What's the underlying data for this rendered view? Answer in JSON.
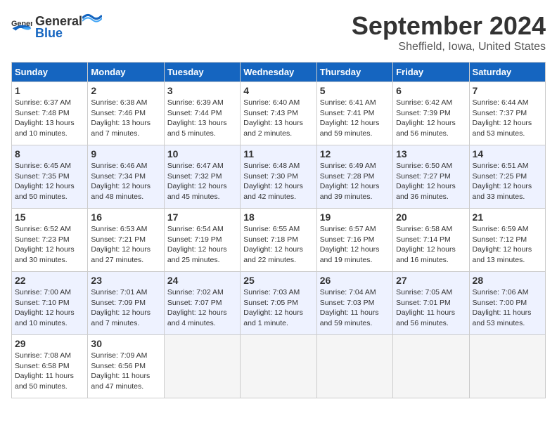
{
  "header": {
    "logo_general": "General",
    "logo_blue": "Blue",
    "title": "September 2024",
    "location": "Sheffield, Iowa, United States"
  },
  "columns": [
    "Sunday",
    "Monday",
    "Tuesday",
    "Wednesday",
    "Thursday",
    "Friday",
    "Saturday"
  ],
  "weeks": [
    [
      {
        "day": "1",
        "sunrise": "6:37 AM",
        "sunset": "7:48 PM",
        "daylight": "13 hours and 10 minutes."
      },
      {
        "day": "2",
        "sunrise": "6:38 AM",
        "sunset": "7:46 PM",
        "daylight": "13 hours and 7 minutes."
      },
      {
        "day": "3",
        "sunrise": "6:39 AM",
        "sunset": "7:44 PM",
        "daylight": "13 hours and 5 minutes."
      },
      {
        "day": "4",
        "sunrise": "6:40 AM",
        "sunset": "7:43 PM",
        "daylight": "13 hours and 2 minutes."
      },
      {
        "day": "5",
        "sunrise": "6:41 AM",
        "sunset": "7:41 PM",
        "daylight": "12 hours and 59 minutes."
      },
      {
        "day": "6",
        "sunrise": "6:42 AM",
        "sunset": "7:39 PM",
        "daylight": "12 hours and 56 minutes."
      },
      {
        "day": "7",
        "sunrise": "6:44 AM",
        "sunset": "7:37 PM",
        "daylight": "12 hours and 53 minutes."
      }
    ],
    [
      {
        "day": "8",
        "sunrise": "6:45 AM",
        "sunset": "7:35 PM",
        "daylight": "12 hours and 50 minutes."
      },
      {
        "day": "9",
        "sunrise": "6:46 AM",
        "sunset": "7:34 PM",
        "daylight": "12 hours and 48 minutes."
      },
      {
        "day": "10",
        "sunrise": "6:47 AM",
        "sunset": "7:32 PM",
        "daylight": "12 hours and 45 minutes."
      },
      {
        "day": "11",
        "sunrise": "6:48 AM",
        "sunset": "7:30 PM",
        "daylight": "12 hours and 42 minutes."
      },
      {
        "day": "12",
        "sunrise": "6:49 AM",
        "sunset": "7:28 PM",
        "daylight": "12 hours and 39 minutes."
      },
      {
        "day": "13",
        "sunrise": "6:50 AM",
        "sunset": "7:27 PM",
        "daylight": "12 hours and 36 minutes."
      },
      {
        "day": "14",
        "sunrise": "6:51 AM",
        "sunset": "7:25 PM",
        "daylight": "12 hours and 33 minutes."
      }
    ],
    [
      {
        "day": "15",
        "sunrise": "6:52 AM",
        "sunset": "7:23 PM",
        "daylight": "12 hours and 30 minutes."
      },
      {
        "day": "16",
        "sunrise": "6:53 AM",
        "sunset": "7:21 PM",
        "daylight": "12 hours and 27 minutes."
      },
      {
        "day": "17",
        "sunrise": "6:54 AM",
        "sunset": "7:19 PM",
        "daylight": "12 hours and 25 minutes."
      },
      {
        "day": "18",
        "sunrise": "6:55 AM",
        "sunset": "7:18 PM",
        "daylight": "12 hours and 22 minutes."
      },
      {
        "day": "19",
        "sunrise": "6:57 AM",
        "sunset": "7:16 PM",
        "daylight": "12 hours and 19 minutes."
      },
      {
        "day": "20",
        "sunrise": "6:58 AM",
        "sunset": "7:14 PM",
        "daylight": "12 hours and 16 minutes."
      },
      {
        "day": "21",
        "sunrise": "6:59 AM",
        "sunset": "7:12 PM",
        "daylight": "12 hours and 13 minutes."
      }
    ],
    [
      {
        "day": "22",
        "sunrise": "7:00 AM",
        "sunset": "7:10 PM",
        "daylight": "12 hours and 10 minutes."
      },
      {
        "day": "23",
        "sunrise": "7:01 AM",
        "sunset": "7:09 PM",
        "daylight": "12 hours and 7 minutes."
      },
      {
        "day": "24",
        "sunrise": "7:02 AM",
        "sunset": "7:07 PM",
        "daylight": "12 hours and 4 minutes."
      },
      {
        "day": "25",
        "sunrise": "7:03 AM",
        "sunset": "7:05 PM",
        "daylight": "12 hours and 1 minute."
      },
      {
        "day": "26",
        "sunrise": "7:04 AM",
        "sunset": "7:03 PM",
        "daylight": "11 hours and 59 minutes."
      },
      {
        "day": "27",
        "sunrise": "7:05 AM",
        "sunset": "7:01 PM",
        "daylight": "11 hours and 56 minutes."
      },
      {
        "day": "28",
        "sunrise": "7:06 AM",
        "sunset": "7:00 PM",
        "daylight": "11 hours and 53 minutes."
      }
    ],
    [
      {
        "day": "29",
        "sunrise": "7:08 AM",
        "sunset": "6:58 PM",
        "daylight": "11 hours and 50 minutes."
      },
      {
        "day": "30",
        "sunrise": "7:09 AM",
        "sunset": "6:56 PM",
        "daylight": "11 hours and 47 minutes."
      },
      null,
      null,
      null,
      null,
      null
    ]
  ],
  "labels": {
    "sunrise": "Sunrise:",
    "sunset": "Sunset:",
    "daylight": "Daylight:"
  }
}
